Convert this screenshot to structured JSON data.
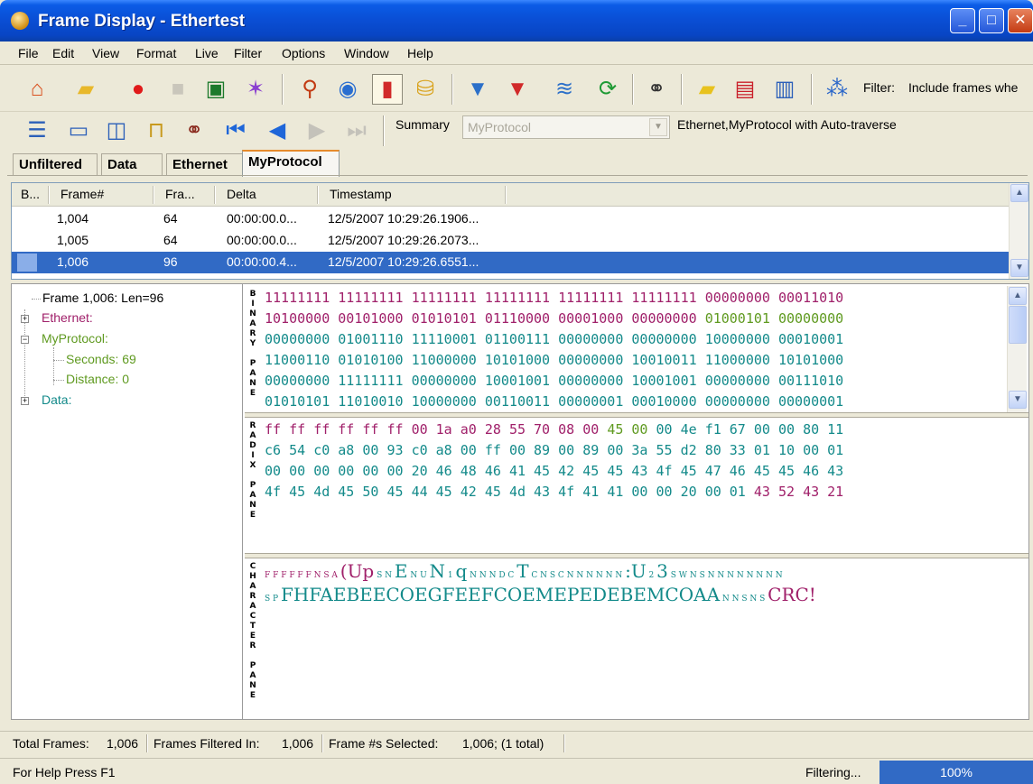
{
  "window": {
    "title": "Frame Display - Ethertest",
    "minimize": "_",
    "maximize": "□",
    "close": "✕"
  },
  "menu": [
    "File",
    "Edit",
    "View",
    "Format",
    "Live",
    "Filter",
    "Options",
    "Window",
    "Help"
  ],
  "toolbar": {
    "filter_label": "Filter:",
    "filter_text": "Include frames whe",
    "summary_label": "Summary",
    "summary_value": "MyProtocol",
    "traverse_text": "Ethernet,MyProtocol with Auto-traverse"
  },
  "tabs": [
    "Unfiltered",
    "Data",
    "Ethernet",
    "MyProtocol"
  ],
  "frame_list": {
    "columns": [
      "B...",
      "Frame#",
      "Fra...",
      "Delta",
      "Timestamp"
    ],
    "rows": [
      {
        "frame": "1,004",
        "size": "64",
        "delta": "00:00:00.0...",
        "timestamp": "12/5/2007 10:29:26.1906..."
      },
      {
        "frame": "1,005",
        "size": "64",
        "delta": "00:00:00.0...",
        "timestamp": "12/5/2007 10:29:26.2073..."
      },
      {
        "frame": "1,006",
        "size": "96",
        "delta": "00:00:00.4...",
        "timestamp": "12/5/2007 10:29:26.6551..."
      }
    ],
    "selected_index": 2
  },
  "tree": {
    "root": "Frame 1,006:  Len=96",
    "ethernet": "Ethernet:",
    "myprotocol": "MyProtocol:",
    "seconds": "Seconds: 69",
    "distance": "Distance: 0",
    "data": "Data:"
  },
  "pane_labels": {
    "binary": "BINARY PANE",
    "radix": "RADIX PANE",
    "character": "CHARACTER PANE"
  },
  "binary_rows": [
    [
      [
        "11111111",
        "mag"
      ],
      [
        "11111111",
        "mag"
      ],
      [
        "11111111",
        "mag"
      ],
      [
        "11111111",
        "mag"
      ],
      [
        "11111111",
        "mag"
      ],
      [
        "11111111",
        "mag"
      ],
      [
        "00000000",
        "mag"
      ],
      [
        "00011010",
        "mag"
      ]
    ],
    [
      [
        "10100000",
        "mag"
      ],
      [
        "00101000",
        "mag"
      ],
      [
        "01010101",
        "mag"
      ],
      [
        "01110000",
        "mag"
      ],
      [
        "00001000",
        "mag"
      ],
      [
        "00000000",
        "mag"
      ],
      [
        "01000101",
        "grn"
      ],
      [
        "00000000",
        "grn"
      ]
    ],
    [
      [
        "00000000",
        "cyan"
      ],
      [
        "01001110",
        "cyan"
      ],
      [
        "11110001",
        "cyan"
      ],
      [
        "01100111",
        "cyan"
      ],
      [
        "00000000",
        "cyan"
      ],
      [
        "00000000",
        "cyan"
      ],
      [
        "10000000",
        "cyan"
      ],
      [
        "00010001",
        "cyan"
      ]
    ],
    [
      [
        "11000110",
        "cyan"
      ],
      [
        "01010100",
        "cyan"
      ],
      [
        "11000000",
        "cyan"
      ],
      [
        "10101000",
        "cyan"
      ],
      [
        "00000000",
        "cyan"
      ],
      [
        "10010011",
        "cyan"
      ],
      [
        "11000000",
        "cyan"
      ],
      [
        "10101000",
        "cyan"
      ]
    ],
    [
      [
        "00000000",
        "cyan"
      ],
      [
        "11111111",
        "cyan"
      ],
      [
        "00000000",
        "cyan"
      ],
      [
        "10001001",
        "cyan"
      ],
      [
        "00000000",
        "cyan"
      ],
      [
        "10001001",
        "cyan"
      ],
      [
        "00000000",
        "cyan"
      ],
      [
        "00111010",
        "cyan"
      ]
    ],
    [
      [
        "01010101",
        "cyan"
      ],
      [
        "11010010",
        "cyan"
      ],
      [
        "10000000",
        "cyan"
      ],
      [
        "00110011",
        "cyan"
      ],
      [
        "00000001",
        "cyan"
      ],
      [
        "00010000",
        "cyan"
      ],
      [
        "00000000",
        "cyan"
      ],
      [
        "00000001",
        "cyan"
      ]
    ]
  ],
  "hex_rows": [
    [
      [
        "ff",
        "mag"
      ],
      [
        "ff",
        "mag"
      ],
      [
        "ff",
        "mag"
      ],
      [
        "ff",
        "mag"
      ],
      [
        "ff",
        "mag"
      ],
      [
        "ff",
        "mag"
      ],
      [
        "00",
        "mag"
      ],
      [
        "1a",
        "mag"
      ],
      [
        "a0",
        "mag"
      ],
      [
        "28",
        "mag"
      ],
      [
        "55",
        "mag"
      ],
      [
        "70",
        "mag"
      ],
      [
        "08",
        "mag"
      ],
      [
        "00",
        "mag"
      ],
      [
        "45",
        "grn"
      ],
      [
        "00",
        "grn"
      ],
      [
        "00",
        "cyan"
      ],
      [
        "4e",
        "cyan"
      ],
      [
        "f1",
        "cyan"
      ],
      [
        "67",
        "cyan"
      ],
      [
        "00",
        "cyan"
      ],
      [
        "00",
        "cyan"
      ],
      [
        "80",
        "cyan"
      ],
      [
        "11",
        "cyan"
      ]
    ],
    [
      [
        "c6",
        "cyan"
      ],
      [
        "54",
        "cyan"
      ],
      [
        "c0",
        "cyan"
      ],
      [
        "a8",
        "cyan"
      ],
      [
        "00",
        "cyan"
      ],
      [
        "93",
        "cyan"
      ],
      [
        "c0",
        "cyan"
      ],
      [
        "a8",
        "cyan"
      ],
      [
        "00",
        "cyan"
      ],
      [
        "ff",
        "cyan"
      ],
      [
        "00",
        "cyan"
      ],
      [
        "89",
        "cyan"
      ],
      [
        "00",
        "cyan"
      ],
      [
        "89",
        "cyan"
      ],
      [
        "00",
        "cyan"
      ],
      [
        "3a",
        "cyan"
      ],
      [
        "55",
        "cyan"
      ],
      [
        "d2",
        "cyan"
      ],
      [
        "80",
        "cyan"
      ],
      [
        "33",
        "cyan"
      ],
      [
        "01",
        "cyan"
      ],
      [
        "10",
        "cyan"
      ],
      [
        "00",
        "cyan"
      ],
      [
        "01",
        "cyan"
      ]
    ],
    [
      [
        "00",
        "cyan"
      ],
      [
        "00",
        "cyan"
      ],
      [
        "00",
        "cyan"
      ],
      [
        "00",
        "cyan"
      ],
      [
        "00",
        "cyan"
      ],
      [
        "00",
        "cyan"
      ],
      [
        "20",
        "cyan"
      ],
      [
        "46",
        "cyan"
      ],
      [
        "48",
        "cyan"
      ],
      [
        "46",
        "cyan"
      ],
      [
        "41",
        "cyan"
      ],
      [
        "45",
        "cyan"
      ],
      [
        "42",
        "cyan"
      ],
      [
        "45",
        "cyan"
      ],
      [
        "45",
        "cyan"
      ],
      [
        "43",
        "cyan"
      ],
      [
        "4f",
        "cyan"
      ],
      [
        "45",
        "cyan"
      ],
      [
        "47",
        "cyan"
      ],
      [
        "46",
        "cyan"
      ],
      [
        "45",
        "cyan"
      ],
      [
        "45",
        "cyan"
      ],
      [
        "46",
        "cyan"
      ],
      [
        "43",
        "cyan"
      ]
    ],
    [
      [
        "4f",
        "cyan"
      ],
      [
        "45",
        "cyan"
      ],
      [
        "4d",
        "cyan"
      ],
      [
        "45",
        "cyan"
      ],
      [
        "50",
        "cyan"
      ],
      [
        "45",
        "cyan"
      ],
      [
        "44",
        "cyan"
      ],
      [
        "45",
        "cyan"
      ],
      [
        "42",
        "cyan"
      ],
      [
        "45",
        "cyan"
      ],
      [
        "4d",
        "cyan"
      ],
      [
        "43",
        "cyan"
      ],
      [
        "4f",
        "cyan"
      ],
      [
        "41",
        "cyan"
      ],
      [
        "41",
        "cyan"
      ],
      [
        "00",
        "cyan"
      ],
      [
        "00",
        "cyan"
      ],
      [
        "20",
        "cyan"
      ],
      [
        "00",
        "cyan"
      ],
      [
        "01",
        "cyan"
      ],
      [
        "43",
        "mag"
      ],
      [
        "52",
        "mag"
      ],
      [
        "43",
        "mag"
      ],
      [
        "21",
        "mag"
      ]
    ]
  ],
  "char_rows": {
    "row1": "(Up",
    "row1b": "E",
    "row1c": "N",
    "row1d": "q",
    "row1e": "T",
    "row1f": ":U",
    "row1g": "3",
    "row2": "FHFAEBEECOEGFEEFCOEMEPEDEBEMCOAA",
    "row2b": "CRC!"
  },
  "status": {
    "total_label": "Total Frames:",
    "total_value": "1,006",
    "filtered_label": "Frames Filtered In:",
    "filtered_value": "1,006",
    "selected_label": "Frame #s Selected:",
    "selected_value": "1,006; (1 total)",
    "help": "For Help Press F1",
    "filtering": "Filtering...",
    "progress": "100%"
  },
  "colors": {
    "selection": "#316ac5",
    "cyan_text": "#138a8a",
    "magenta_text": "#a0206a",
    "green_text": "#5f9a20",
    "title_blue": "#0a4fd6"
  }
}
